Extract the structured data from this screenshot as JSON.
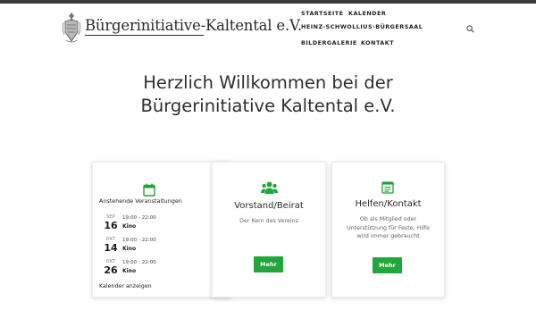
{
  "site": {
    "title": "Bürgerinitiative-Kaltental e.V."
  },
  "nav": {
    "items": [
      "STARTSEITE",
      "KALENDER",
      "HEINZ-SCHWOLLIUS-BÜRGERSAAL",
      "BILDERGALERIE",
      "KONTAKT"
    ]
  },
  "welcome": {
    "line1": "Herzlich Willkommen bei der",
    "line2": "Bürgerinitiative Kaltental e.V."
  },
  "events_card": {
    "heading": "Anstehende Veranstaltungen",
    "events": [
      {
        "month": "SEP",
        "day": "16",
        "time": "19:00 - 22:00",
        "title": "Kino"
      },
      {
        "month": "OKT",
        "day": "14",
        "time": "19:00 - 22:00",
        "title": "Kino"
      },
      {
        "month": "OKT",
        "day": "26",
        "time": "19:00 - 22:00",
        "title": "Kino"
      }
    ],
    "link": "Kalender anzeigen"
  },
  "board_card": {
    "title": "Vorstand/Beirat",
    "description": "Der Kern des Vereins",
    "button": "Mehr"
  },
  "help_card": {
    "title": "Helfen/Kontakt",
    "description_line1": "Ob als Mitglied oder",
    "description_line2": "Unterstützung für Feste, Hilfe",
    "description_line3": "wird immer gebraucht",
    "button": "Mehr"
  },
  "colors": {
    "accent": "#22a53a",
    "topbar": "#3a3a3a"
  }
}
